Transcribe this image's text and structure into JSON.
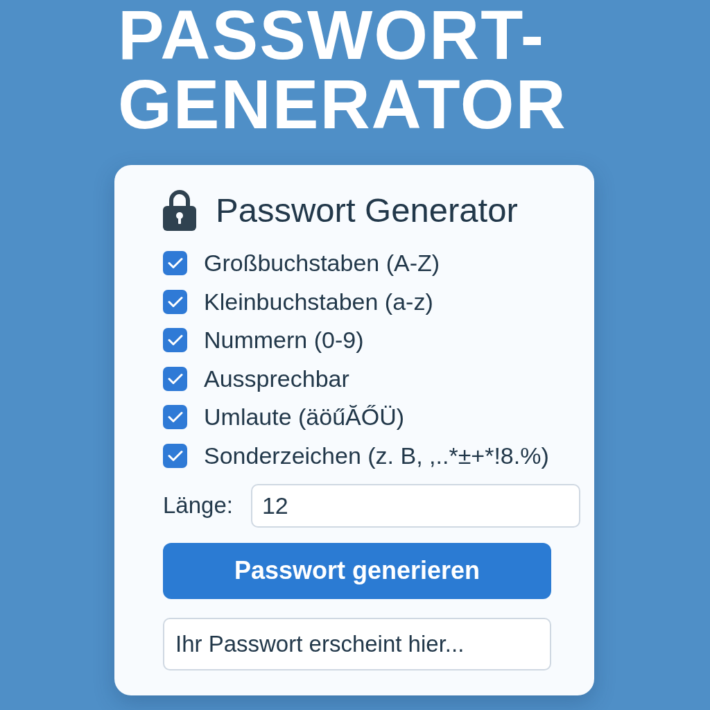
{
  "title": "PASSWORT-GENERATOR",
  "card": {
    "heading": "Passwort Generator",
    "options": [
      {
        "label": "Großbuchstaben (A-Z)",
        "checked": true
      },
      {
        "label": "Kleinbuchstaben (a-z)",
        "checked": true
      },
      {
        "label": "Nummern (0-9)",
        "checked": true
      },
      {
        "label": "Aussprechbar",
        "checked": true
      },
      {
        "label": "Umlaute (äöűĂŐÜ)",
        "checked": true
      },
      {
        "label": "Sonderzeichen (z. B, ,..*±+*!8.%)",
        "checked": true
      }
    ],
    "length": {
      "label": "Länge:",
      "value": "12"
    },
    "button": "Passwort generieren",
    "output": {
      "placeholder": "Ihr Passwort erscheint hier..."
    }
  }
}
